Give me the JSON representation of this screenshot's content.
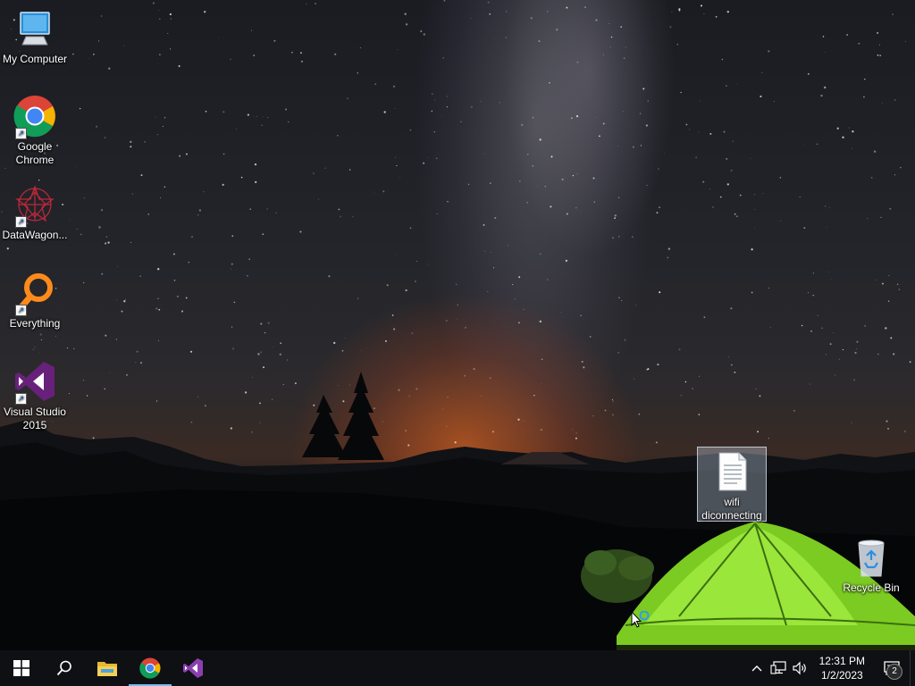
{
  "desktop": {
    "icons": [
      {
        "label": "My Computer",
        "icon": "monitor-icon"
      },
      {
        "label": "Google Chrome",
        "icon": "chrome-icon",
        "shortcut": true
      },
      {
        "label": "DataWagon...",
        "icon": "datawagon-icon",
        "shortcut": true
      },
      {
        "label": "Everything",
        "icon": "everything-search-icon",
        "shortcut": true
      },
      {
        "label": "Visual Studio 2015",
        "icon": "visual-studio-icon",
        "shortcut": true
      },
      {
        "label": "wifi diconnecting",
        "icon": "text-document-icon",
        "selected": true
      },
      {
        "label": "Recycle Bin",
        "icon": "recycle-bin-icon"
      }
    ]
  },
  "taskbar": {
    "start": {
      "icon": "windows-start-icon"
    },
    "search": {
      "icon": "search-icon"
    },
    "pinned": [
      {
        "name": "File Explorer",
        "icon": "folder-icon"
      },
      {
        "name": "Google Chrome",
        "icon": "chrome-icon",
        "active": true
      },
      {
        "name": "Visual Studio",
        "icon": "visual-studio-icon"
      }
    ],
    "tray": {
      "icons": [
        "chevron-up-icon",
        "network-icon",
        "volume-icon"
      ],
      "time": "12:31 PM",
      "date": "1/2/2023",
      "notifications_count": "2"
    }
  },
  "colors": {
    "taskbar_bg": "#0e1014",
    "accent": "#76b9ed",
    "tent_green": "#8ee22a"
  }
}
